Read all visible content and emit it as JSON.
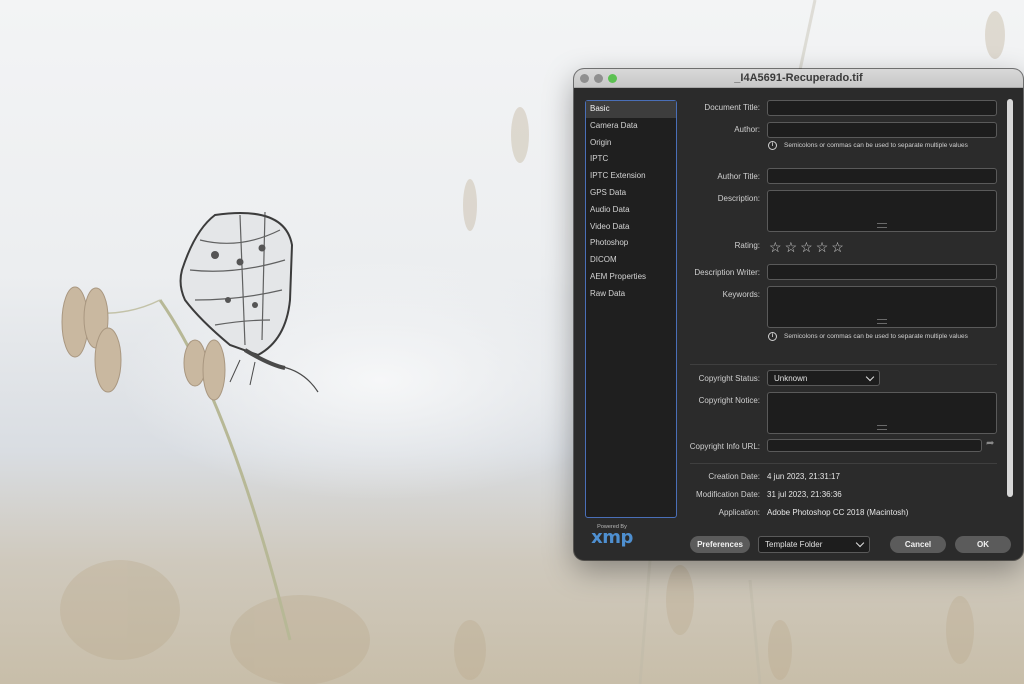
{
  "window": {
    "title": "_I4A5691-Recuperado.tif"
  },
  "categories": [
    "Basic",
    "Camera Data",
    "Origin",
    "IPTC",
    "IPTC Extension",
    "GPS Data",
    "Audio Data",
    "Video Data",
    "Photoshop",
    "DICOM",
    "AEM Properties",
    "Raw Data"
  ],
  "active_category": "Basic",
  "branding": {
    "powered_by": "Powered By",
    "logo_text": "xmp"
  },
  "form": {
    "document_title_label": "Document Title:",
    "author_label": "Author:",
    "author_hint": "Semicolons or commas can be used to separate multiple values",
    "author_title_label": "Author Title:",
    "description_label": "Description:",
    "rating_label": "Rating:",
    "rating_value": 0,
    "rating_max": 5,
    "description_writer_label": "Description Writer:",
    "keywords_label": "Keywords:",
    "keywords_hint": "Semicolons or commas can be used to separate multiple values",
    "copyright_status_label": "Copyright Status:",
    "copyright_status_value": "Unknown",
    "copyright_notice_label": "Copyright Notice:",
    "copyright_url_label": "Copyright Info URL:",
    "creation_date_label": "Creation Date:",
    "creation_date_value": "4 jun 2023, 21:31:17",
    "modification_date_label": "Modification Date:",
    "modification_date_value": "31 jul 2023, 21:36:36",
    "application_label": "Application:",
    "application_value": "Adobe Photoshop CC 2018 (Macintosh)"
  },
  "footer": {
    "preferences_label": "Preferences",
    "template_folder_value": "Template Folder",
    "cancel_label": "Cancel",
    "ok_label": "OK"
  },
  "colors": {
    "dialog_bg": "#2b2b2b",
    "selection_border": "#4a6fb8",
    "traffic_light_green": "#5cc152",
    "xmp_blue": "#4e8fd0"
  }
}
